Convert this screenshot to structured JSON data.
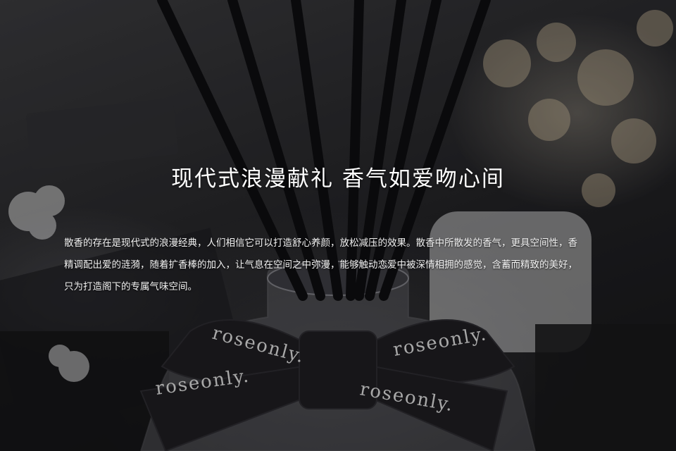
{
  "headline": "现代式浪漫献礼 香气如爱吻心间",
  "body_lines": [
    "散香的存在是现代式的浪漫经典，人们相信它可以打造舒心养颜，放松减压的效果。散香中所散发的香气，更具空间性，香",
    "精调配出爱的涟漪，随着扩香棒的加入，让气息在空间之中弥漫，能够触动恋爱中被深情相拥的感觉，含蓄而精致的美好，",
    "只为打造阁下的专属气味空间。"
  ],
  "brand_ribbon": "roseonly.",
  "colors": {
    "text": "#ffffff",
    "background": "#1b1b1d",
    "ribbon": "#1e1d21"
  }
}
